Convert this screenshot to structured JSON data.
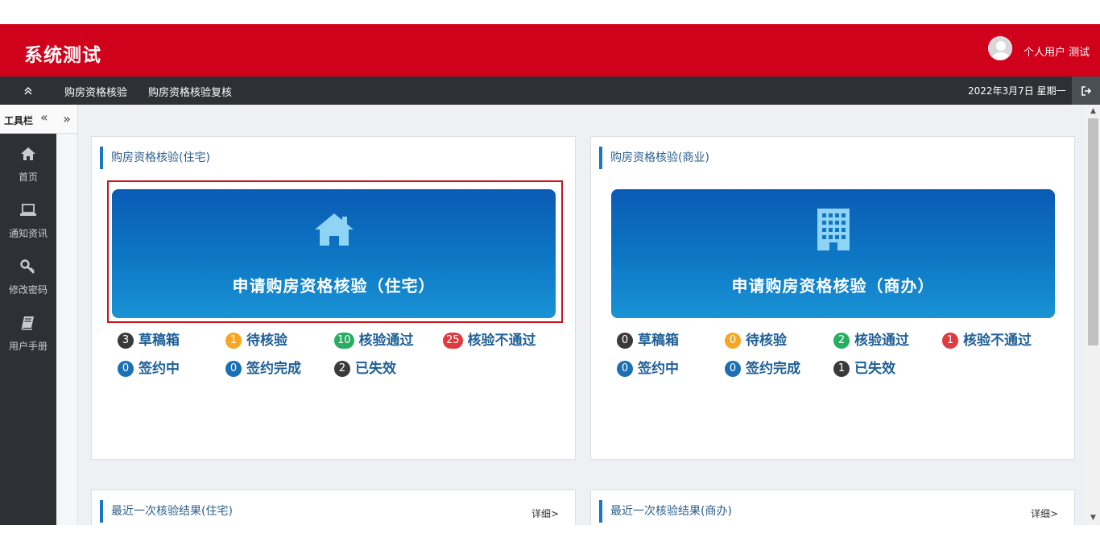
{
  "header": {
    "title": "系统测试",
    "user": "个人用户 测试"
  },
  "nav": {
    "links": [
      "购房资格核验",
      "购房资格核验复核"
    ],
    "date": "2022年3月7日 星期一"
  },
  "sidebar": {
    "toolbar_label": "工具栏",
    "items": [
      {
        "label": "首页",
        "icon": "home-icon"
      },
      {
        "label": "通知资讯",
        "icon": "laptop-icon"
      },
      {
        "label": "修改密码",
        "icon": "key-icon"
      },
      {
        "label": "用户手册",
        "icon": "book-icon"
      }
    ]
  },
  "cards": [
    {
      "title": "购房资格核验(住宅)",
      "button_label": "申请购房资格核验（住宅）",
      "button_icon": "house-icon",
      "stats": [
        {
          "count": "3",
          "label": "草稿箱",
          "color": "#3a3a3a"
        },
        {
          "count": "1",
          "label": "待核验",
          "color": "#f5a623"
        },
        {
          "count": "10",
          "label": "核验通过",
          "color": "#27ae60"
        },
        {
          "count": "25",
          "label": "核验不通过",
          "color": "#e0393e"
        },
        {
          "count": "0",
          "label": "签约中",
          "color": "#1a6fb5"
        },
        {
          "count": "0",
          "label": "签约完成",
          "color": "#1a6fb5"
        },
        {
          "count": "2",
          "label": "已失效",
          "color": "#3a3a3a"
        }
      ]
    },
    {
      "title": "购房资格核验(商业)",
      "button_label": "申请购房资格核验（商办）",
      "button_icon": "building-icon",
      "stats": [
        {
          "count": "0",
          "label": "草稿箱",
          "color": "#3a3a3a"
        },
        {
          "count": "0",
          "label": "待核验",
          "color": "#f5a623"
        },
        {
          "count": "2",
          "label": "核验通过",
          "color": "#27ae60"
        },
        {
          "count": "1",
          "label": "核验不通过",
          "color": "#e0393e"
        },
        {
          "count": "0",
          "label": "签约中",
          "color": "#1a6fb5"
        },
        {
          "count": "0",
          "label": "签约完成",
          "color": "#1a6fb5"
        },
        {
          "count": "1",
          "label": "已失效",
          "color": "#3a3a3a"
        }
      ]
    }
  ],
  "recent": [
    {
      "title": "最近一次核验结果(住宅)",
      "detail": "详细>"
    },
    {
      "title": "最近一次核验结果(商办)",
      "detail": "详细>"
    }
  ],
  "colors": {
    "header": "#d0021b",
    "nav": "#2d3035",
    "button": "#0d78c5",
    "highlight": "#c7161e"
  }
}
